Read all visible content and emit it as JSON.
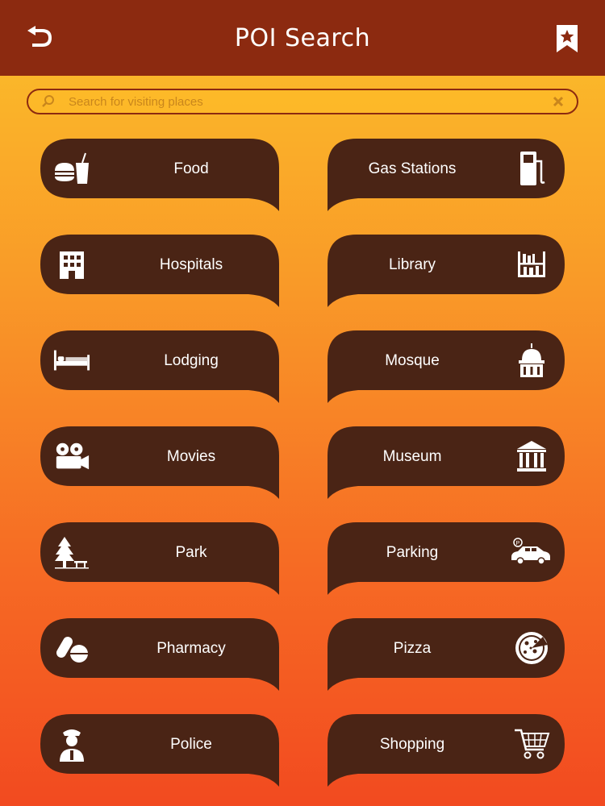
{
  "header": {
    "title": "POI Search",
    "back_icon": "back-arrow-icon",
    "bookmark_icon": "bookmark-star-icon"
  },
  "search": {
    "placeholder": "Search for visiting places",
    "value": "",
    "search_icon": "search-icon",
    "clear_icon": "clear-icon"
  },
  "colors": {
    "header_bg": "#8c2a10",
    "button_bg": "#4a2415",
    "gradient_top": "#fbc12a",
    "gradient_bottom": "#f24a20",
    "text": "#ffffff"
  },
  "categories": [
    {
      "label": "Food",
      "icon": "burger-drink-icon"
    },
    {
      "label": "Gas Stations",
      "icon": "fuel-pump-icon"
    },
    {
      "label": "Hospitals",
      "icon": "hospital-building-icon"
    },
    {
      "label": "Library",
      "icon": "bookshelf-icon"
    },
    {
      "label": "Lodging",
      "icon": "bed-icon"
    },
    {
      "label": "Mosque",
      "icon": "mosque-dome-icon"
    },
    {
      "label": "Movies",
      "icon": "film-projector-icon"
    },
    {
      "label": "Museum",
      "icon": "museum-building-icon"
    },
    {
      "label": "Park",
      "icon": "tree-bench-icon"
    },
    {
      "label": "Parking",
      "icon": "parking-car-icon"
    },
    {
      "label": "Pharmacy",
      "icon": "pills-icon"
    },
    {
      "label": "Pizza",
      "icon": "pizza-icon"
    },
    {
      "label": "Police",
      "icon": "police-officer-icon"
    },
    {
      "label": "Shopping",
      "icon": "shopping-cart-icon"
    }
  ]
}
